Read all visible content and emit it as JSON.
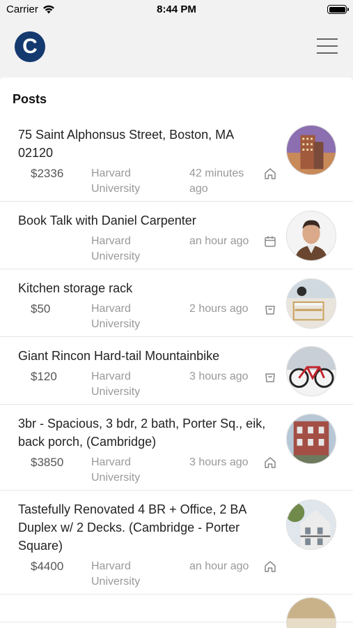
{
  "status_bar": {
    "carrier": "Carrier",
    "time": "8:44 PM"
  },
  "header": {
    "logo_letter": "C"
  },
  "section": {
    "title": "Posts"
  },
  "posts": [
    {
      "title": "75 Saint Alphonsus Street, Boston, MA 02120",
      "price": "$2336",
      "school": "Harvard University",
      "ago": "42 minutes ago",
      "type_icon": "home-icon"
    },
    {
      "title": "Book Talk with Daniel Carpenter",
      "price": "",
      "school": "Harvard University",
      "ago": "an hour ago",
      "type_icon": "calendar-icon"
    },
    {
      "title": "Kitchen storage rack",
      "price": "$50",
      "school": "Harvard University",
      "ago": "2 hours ago",
      "type_icon": "shopping-bag-icon"
    },
    {
      "title": "Giant Rincon Hard-tail Mountainbike",
      "price": "$120",
      "school": "Harvard University",
      "ago": "3 hours ago",
      "type_icon": "shopping-bag-icon"
    },
    {
      "title": "3br - Spacious, 3 bdr, 2 bath, Porter Sq., eik, back porch, (Cambridge)",
      "price": "$3850",
      "school": "Harvard University",
      "ago": "3 hours ago",
      "type_icon": "home-icon"
    },
    {
      "title": "Tastefully Renovated 4 BR + Office, 2 BA Duplex w/ 2 Decks. (Cambridge - Porter Square)",
      "price": "$4400",
      "school": "Harvard University",
      "ago": "an hour ago",
      "type_icon": "home-icon"
    }
  ],
  "colors": {
    "brand": "#14396f",
    "muted_text": "#999999",
    "background": "#f2f2f2"
  }
}
